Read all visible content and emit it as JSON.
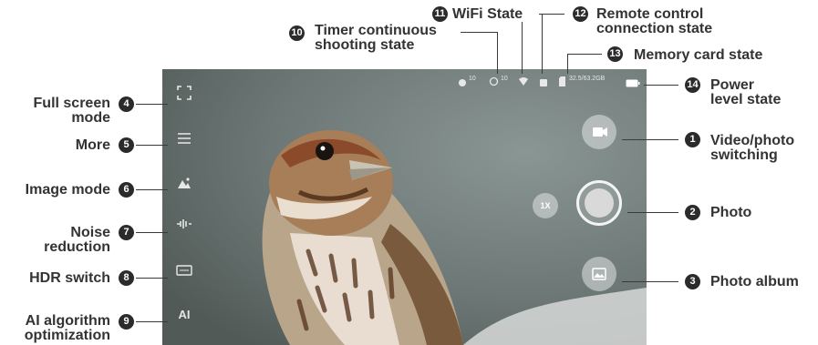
{
  "status_bar": {
    "timer": "10",
    "continuous": "10",
    "memory": "32.5/63.2GB"
  },
  "left_controls": {
    "fullscreen": {
      "num": "4",
      "label_1": "Full screen",
      "label_2": "mode"
    },
    "more": {
      "num": "5",
      "label": "More"
    },
    "image_mode": {
      "num": "6",
      "label": "Image mode"
    },
    "noise": {
      "num": "7",
      "label_1": "Noise",
      "label_2": "reduction"
    },
    "hdr": {
      "num": "8",
      "label": "HDR switch"
    },
    "ai": {
      "num": "9",
      "label_1": "AI algorithm",
      "label_2": "optimization",
      "icon_text": "AI"
    }
  },
  "top_callouts": {
    "timer": {
      "num": "10",
      "label_1": "Timer continuous",
      "label_2": "shooting state"
    },
    "wifi": {
      "num": "11",
      "label": "WiFi State"
    },
    "remote": {
      "num": "12",
      "label_1": "Remote control",
      "label_2": "connection state"
    },
    "memory": {
      "num": "13",
      "label": "Memory card state"
    }
  },
  "right_controls": {
    "power": {
      "num": "14",
      "label_1": "Power",
      "label_2": "level state"
    },
    "video_photo": {
      "num": "1",
      "label_1": "Video/photo",
      "label_2": "switching"
    },
    "photo": {
      "num": "2",
      "label": "Photo"
    },
    "album": {
      "num": "3",
      "label": "Photo album"
    },
    "zoom": "1X"
  }
}
